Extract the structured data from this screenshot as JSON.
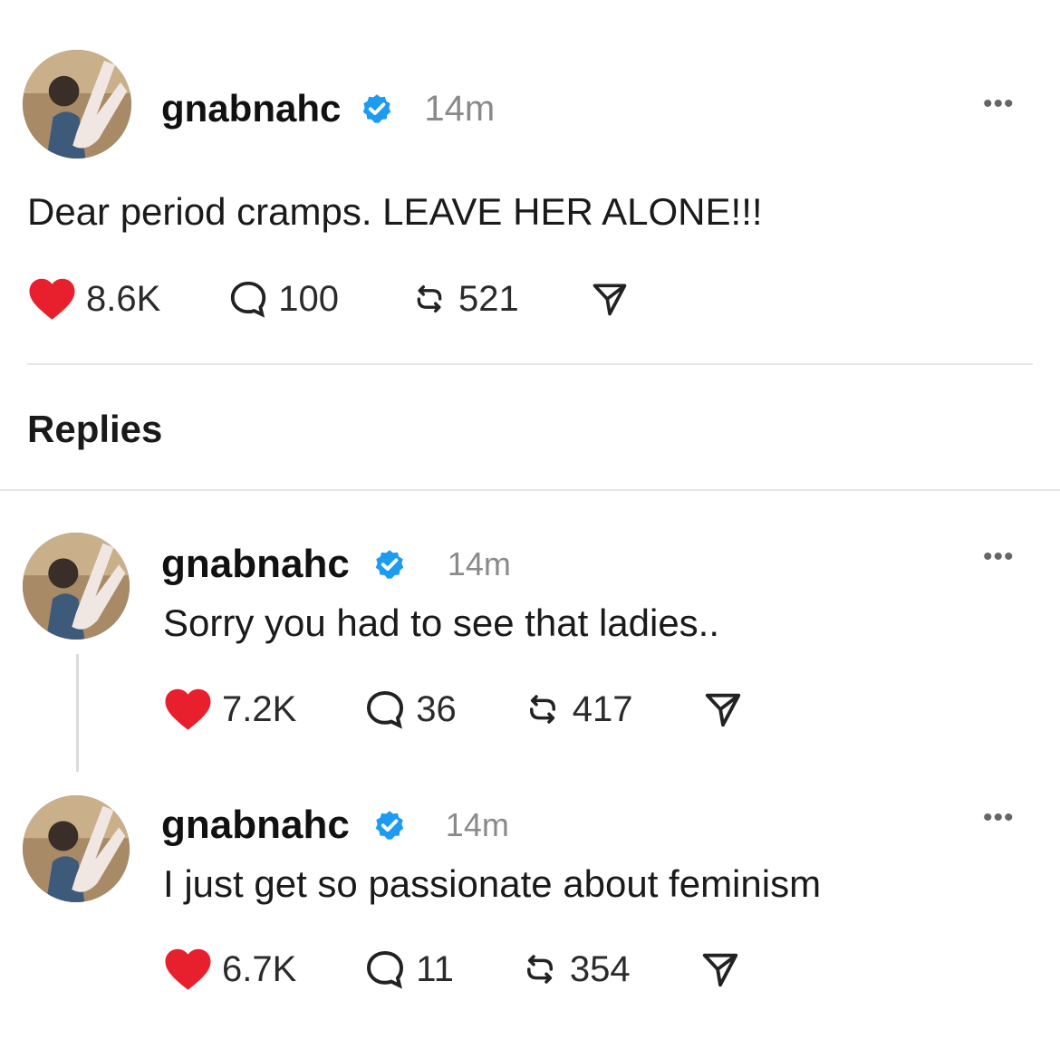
{
  "post": {
    "username": "gnabnahc",
    "time": "14m",
    "text": "Dear period cramps. LEAVE HER ALONE!!!",
    "likes": "8.6K",
    "comments": "100",
    "reposts": "521"
  },
  "replies_header": "Replies",
  "replies": [
    {
      "username": "gnabnahc",
      "time": "14m",
      "text": "Sorry you had to see that ladies..",
      "likes": "7.2K",
      "comments": "36",
      "reposts": "417"
    },
    {
      "username": "gnabnahc",
      "time": "14m",
      "text": "I just get so passionate about feminism",
      "likes": "6.7K",
      "comments": "11",
      "reposts": "354"
    }
  ],
  "icons": {
    "like": "heart-icon",
    "comment": "comment-bubble-icon",
    "repost": "repost-icon",
    "share": "send-icon",
    "verified": "verified-badge-icon",
    "more": "more-options-icon"
  },
  "colors": {
    "like": "#e8202e",
    "verified": "#1d9bf0",
    "muted": "#8a8a8a"
  }
}
